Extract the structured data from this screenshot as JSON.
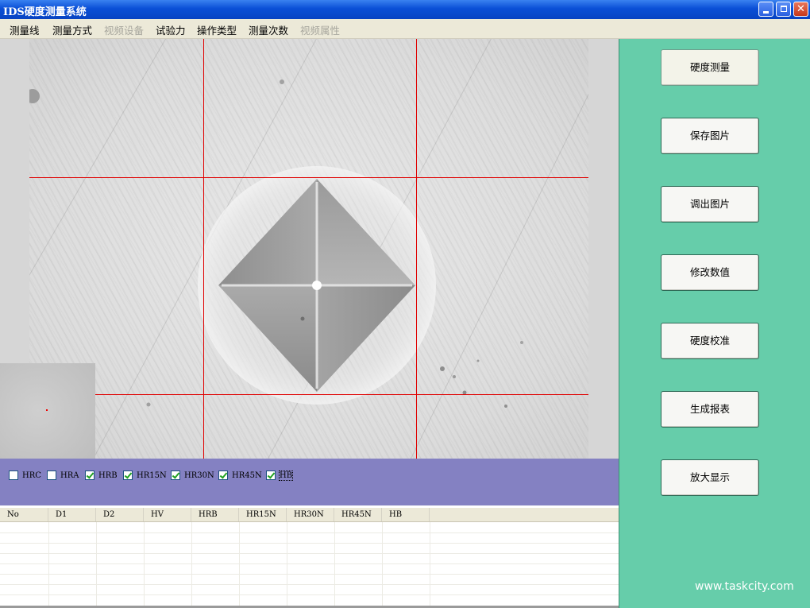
{
  "window": {
    "title": "IDS硬度测量系统"
  },
  "menu": [
    {
      "label": "测量线",
      "enabled": true
    },
    {
      "label": "测量方式",
      "enabled": true
    },
    {
      "label": "视频设备",
      "enabled": false
    },
    {
      "label": "试验力",
      "enabled": true
    },
    {
      "label": "操作类型",
      "enabled": true
    },
    {
      "label": "测量次数",
      "enabled": true
    },
    {
      "label": "视频属性",
      "enabled": false
    }
  ],
  "checkboxes": [
    {
      "label": "HRC",
      "checked": false
    },
    {
      "label": "HRA",
      "checked": false
    },
    {
      "label": "HRB",
      "checked": true
    },
    {
      "label": "HR15N",
      "checked": true
    },
    {
      "label": "HR30N",
      "checked": true
    },
    {
      "label": "HR45N",
      "checked": true
    },
    {
      "label": "HB",
      "checked": true
    }
  ],
  "table": {
    "columns": [
      "No",
      "D1",
      "D2",
      "HV",
      "HRB",
      "HR15N",
      "HR30N",
      "HR45N",
      "HB"
    ],
    "rows": []
  },
  "side_buttons": [
    "硬度测量",
    "保存图片",
    "调出图片",
    "修改数值",
    "硬度校准",
    "生成报表",
    "放大显示"
  ],
  "watermark": "www.taskcity.com",
  "colors": {
    "side_panel": "#66cdaa",
    "checkbox_strip": "#8481c2",
    "crosshair": "#e00000"
  }
}
